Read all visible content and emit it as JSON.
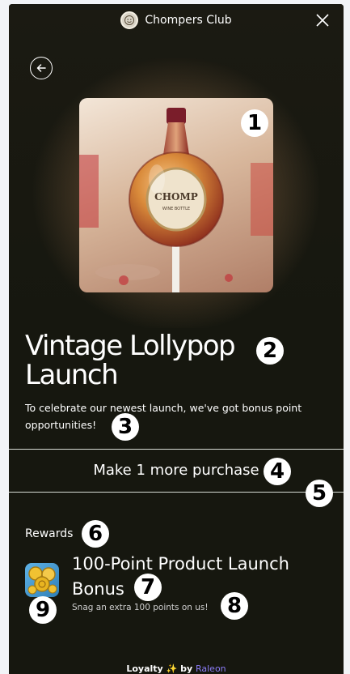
{
  "header": {
    "brand_name": "Chompers Club",
    "brand_logo_icon": "chompers-club-logo",
    "close_icon": "close-icon"
  },
  "navigation": {
    "back_icon": "arrow-left-icon"
  },
  "campaign": {
    "image_subject": "wine-bottle-lollipop",
    "image_badge": "1",
    "title": "Vintage Lollypop Launch",
    "title_badge": "2",
    "description": "To celebrate our newest launch, we've got bonus point opportunities!",
    "description_badge": "3"
  },
  "progress": {
    "text": "Make 1 more purchase",
    "text_badge": "4",
    "divider_badge": "5"
  },
  "rewards": {
    "label": "Rewards",
    "label_badge": "6",
    "items": [
      {
        "title": "100-Point Product Launch Bonus",
        "title_badge": "7",
        "description": "Snag an extra 100 points on us!",
        "description_badge": "8",
        "icon": "coins-bonus-icon",
        "icon_badge": "9"
      }
    ]
  },
  "footer": {
    "prefix": "Loyalty",
    "sparkle": "✨",
    "by": "by",
    "provider": "Raleon"
  },
  "colors": {
    "panel_background": "#16170f",
    "text": "#ffffff",
    "divider": "#d8dcd6",
    "provider_link": "#8b7cf6"
  }
}
